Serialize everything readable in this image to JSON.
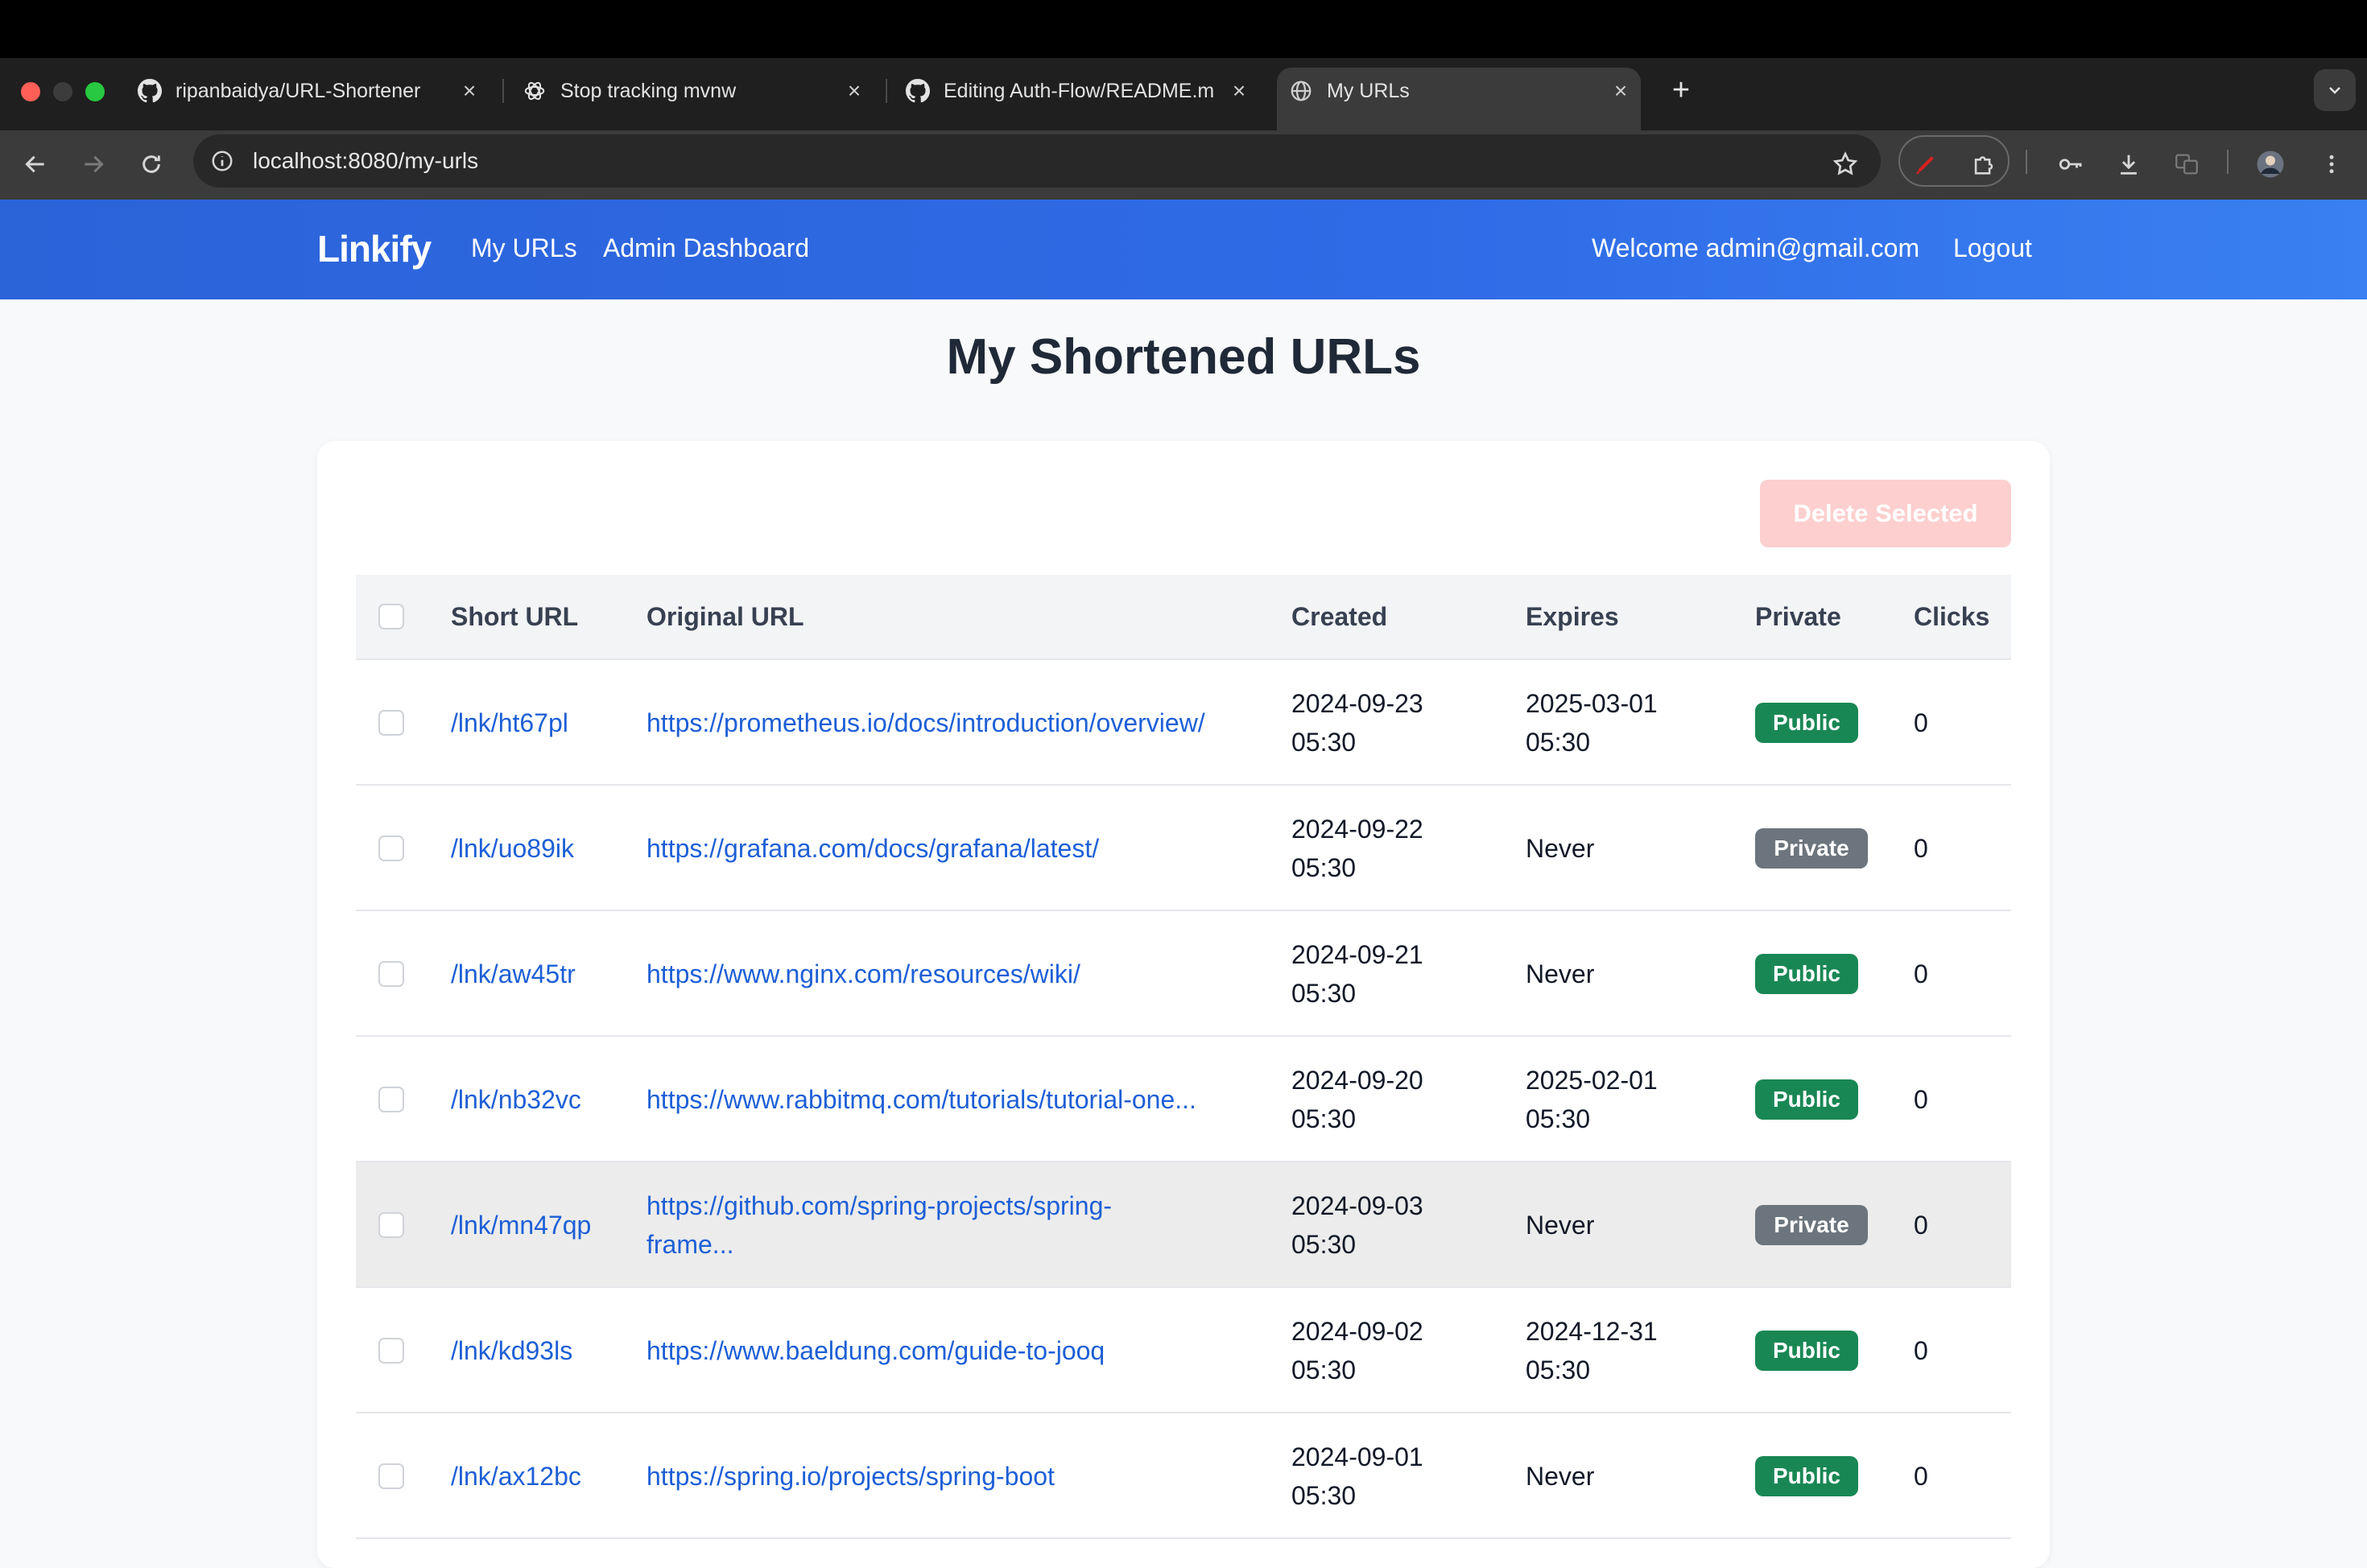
{
  "browser": {
    "tabs": [
      {
        "title": "ripanbaidya/URL-Shortener",
        "icon": "github-icon"
      },
      {
        "title": "Stop tracking mvnw",
        "icon": "chatgpt-icon"
      },
      {
        "title": "Editing Auth-Flow/README.m",
        "icon": "github-icon"
      },
      {
        "title": "My URLs",
        "icon": "globe-icon"
      }
    ],
    "url": "localhost:8080/my-urls"
  },
  "navbar": {
    "brand": "Linkify",
    "my_urls": "My URLs",
    "admin_dashboard": "Admin Dashboard",
    "welcome": "Welcome admin@gmail.com",
    "logout": "Logout"
  },
  "page": {
    "title": "My Shortened URLs",
    "delete_selected": "Delete Selected"
  },
  "table": {
    "headers": {
      "short_url": "Short URL",
      "original_url": "Original URL",
      "created": "Created",
      "expires": "Expires",
      "private": "Private",
      "clicks": "Clicks"
    },
    "rows": [
      {
        "short": "/lnk/ht67pl",
        "original": "https://prometheus.io/docs/introduction/overview/",
        "original2": "",
        "created_date": "2024-09-23",
        "created_time": "05:30",
        "expires_date": "2025-03-01",
        "expires_time": "05:30",
        "visibility": "Public",
        "clicks": "0"
      },
      {
        "short": "/lnk/uo89ik",
        "original": "https://grafana.com/docs/grafana/latest/",
        "original2": "",
        "created_date": "2024-09-22",
        "created_time": "05:30",
        "expires_date": "Never",
        "expires_time": "",
        "visibility": "Private",
        "clicks": "0"
      },
      {
        "short": "/lnk/aw45tr",
        "original": "https://www.nginx.com/resources/wiki/",
        "original2": "",
        "created_date": "2024-09-21",
        "created_time": "05:30",
        "expires_date": "Never",
        "expires_time": "",
        "visibility": "Public",
        "clicks": "0"
      },
      {
        "short": "/lnk/nb32vc",
        "original": "https://www.rabbitmq.com/tutorials/tutorial-one...",
        "original2": "",
        "created_date": "2024-09-20",
        "created_time": "05:30",
        "expires_date": "2025-02-01",
        "expires_time": "05:30",
        "visibility": "Public",
        "clicks": "0"
      },
      {
        "short": "/lnk/mn47qp",
        "original": "https://github.com/spring-projects/spring-",
        "original2": "frame...",
        "created_date": "2024-09-03",
        "created_time": "05:30",
        "expires_date": "Never",
        "expires_time": "",
        "visibility": "Private",
        "clicks": "0"
      },
      {
        "short": "/lnk/kd93ls",
        "original": "https://www.baeldung.com/guide-to-jooq",
        "original2": "",
        "created_date": "2024-09-02",
        "created_time": "05:30",
        "expires_date": "2024-12-31",
        "expires_time": "05:30",
        "visibility": "Public",
        "clicks": "0"
      },
      {
        "short": "/lnk/ax12bc",
        "original": "https://spring.io/projects/spring-boot",
        "original2": "",
        "created_date": "2024-09-01",
        "created_time": "05:30",
        "expires_date": "Never",
        "expires_time": "",
        "visibility": "Public",
        "clicks": "0"
      }
    ]
  },
  "colors": {
    "navbar": "#2f6be6",
    "link": "#1d5fd6",
    "public_badge": "#198754",
    "private_badge": "#6c757d",
    "delete_button": "#fdcfcf"
  }
}
